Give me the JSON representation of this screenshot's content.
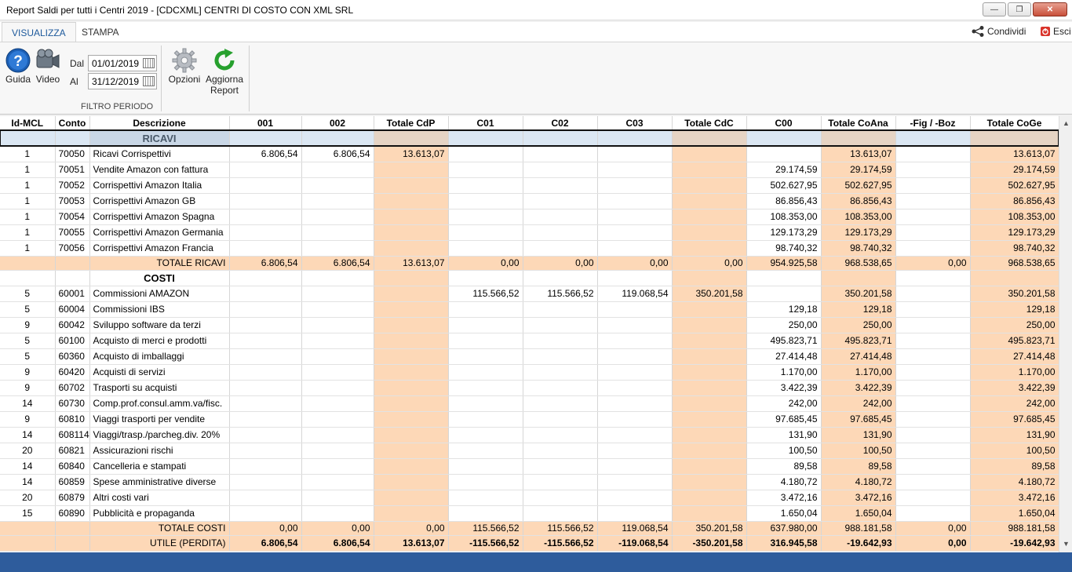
{
  "window": {
    "title": "Report Saldi per tutti i Centri 2019 - [CDCXML] CENTRI DI COSTO CON XML SRL",
    "min": "—",
    "max": "❐",
    "close": "✕"
  },
  "tabs": [
    {
      "label": "VISUALIZZA"
    },
    {
      "label": "STAMPA"
    }
  ],
  "topright": {
    "share": "Condividi",
    "exit": "Esci"
  },
  "ribbon": {
    "guida": "Guida",
    "video": "Video",
    "dal_label": "Dal",
    "al_label": "Al",
    "dal_value": "01/01/2019",
    "al_value": "31/12/2019",
    "group_label": "FILTRO PERIODO",
    "opzioni": "Opzioni",
    "aggiorna1": "Aggiorna",
    "aggiorna2": "Report"
  },
  "columns": [
    "Id-MCL",
    "Conto",
    "Descrizione",
    "001",
    "002",
    "Totale CdP",
    "C01",
    "C02",
    "C03",
    "Totale CdC",
    "C00",
    "Totale CoAna",
    "-Fig / -Boz",
    "Totale CoGe"
  ],
  "sections": {
    "ricavi": "RICAVI",
    "costi": "COSTI"
  },
  "ricavi_rows": [
    [
      "1",
      "70050",
      "Ricavi Corrispettivi",
      "6.806,54",
      "6.806,54",
      "13.613,07",
      "",
      "",
      "",
      "",
      "",
      "13.613,07",
      "",
      "13.613,07"
    ],
    [
      "1",
      "70051",
      "Vendite Amazon con fattura",
      "",
      "",
      "",
      "",
      "",
      "",
      "",
      "29.174,59",
      "29.174,59",
      "",
      "29.174,59"
    ],
    [
      "1",
      "70052",
      "Corrispettivi Amazon Italia",
      "",
      "",
      "",
      "",
      "",
      "",
      "",
      "502.627,95",
      "502.627,95",
      "",
      "502.627,95"
    ],
    [
      "1",
      "70053",
      "Corrispettivi Amazon GB",
      "",
      "",
      "",
      "",
      "",
      "",
      "",
      "86.856,43",
      "86.856,43",
      "",
      "86.856,43"
    ],
    [
      "1",
      "70054",
      "Corrispettivi Amazon Spagna",
      "",
      "",
      "",
      "",
      "",
      "",
      "",
      "108.353,00",
      "108.353,00",
      "",
      "108.353,00"
    ],
    [
      "1",
      "70055",
      "Corrispettivi Amazon Germania",
      "",
      "",
      "",
      "",
      "",
      "",
      "",
      "129.173,29",
      "129.173,29",
      "",
      "129.173,29"
    ],
    [
      "1",
      "70056",
      "Corrispettivi Amazon Francia",
      "",
      "",
      "",
      "",
      "",
      "",
      "",
      "98.740,32",
      "98.740,32",
      "",
      "98.740,32"
    ]
  ],
  "totale_ricavi": [
    "TOTALE RICAVI",
    "6.806,54",
    "6.806,54",
    "13.613,07",
    "0,00",
    "0,00",
    "0,00",
    "0,00",
    "954.925,58",
    "968.538,65",
    "0,00",
    "968.538,65"
  ],
  "costi_rows": [
    [
      "5",
      "60001",
      "Commissioni AMAZON",
      "",
      "",
      "",
      "115.566,52",
      "115.566,52",
      "119.068,54",
      "350.201,58",
      "",
      "350.201,58",
      "",
      "350.201,58"
    ],
    [
      "5",
      "60004",
      "Commissioni IBS",
      "",
      "",
      "",
      "",
      "",
      "",
      "",
      "129,18",
      "129,18",
      "",
      "129,18"
    ],
    [
      "9",
      "60042",
      "Sviluppo software da terzi",
      "",
      "",
      "",
      "",
      "",
      "",
      "",
      "250,00",
      "250,00",
      "",
      "250,00"
    ],
    [
      "5",
      "60100",
      "Acquisto di merci e prodotti",
      "",
      "",
      "",
      "",
      "",
      "",
      "",
      "495.823,71",
      "495.823,71",
      "",
      "495.823,71"
    ],
    [
      "5",
      "60360",
      "Acquisto di imballaggi",
      "",
      "",
      "",
      "",
      "",
      "",
      "",
      "27.414,48",
      "27.414,48",
      "",
      "27.414,48"
    ],
    [
      "9",
      "60420",
      "Acquisti di servizi",
      "",
      "",
      "",
      "",
      "",
      "",
      "",
      "1.170,00",
      "1.170,00",
      "",
      "1.170,00"
    ],
    [
      "9",
      "60702",
      "Trasporti su acquisti",
      "",
      "",
      "",
      "",
      "",
      "",
      "",
      "3.422,39",
      "3.422,39",
      "",
      "3.422,39"
    ],
    [
      "14",
      "60730",
      "Comp.prof.consul.amm.va/fisc.",
      "",
      "",
      "",
      "",
      "",
      "",
      "",
      "242,00",
      "242,00",
      "",
      "242,00"
    ],
    [
      "9",
      "60810",
      "Viaggi trasporti per vendite",
      "",
      "",
      "",
      "",
      "",
      "",
      "",
      "97.685,45",
      "97.685,45",
      "",
      "97.685,45"
    ],
    [
      "14",
      "608114",
      "Viaggi/trasp./parcheg.div. 20%",
      "",
      "",
      "",
      "",
      "",
      "",
      "",
      "131,90",
      "131,90",
      "",
      "131,90"
    ],
    [
      "20",
      "60821",
      "Assicurazioni rischi",
      "",
      "",
      "",
      "",
      "",
      "",
      "",
      "100,50",
      "100,50",
      "",
      "100,50"
    ],
    [
      "14",
      "60840",
      "Cancelleria e stampati",
      "",
      "",
      "",
      "",
      "",
      "",
      "",
      "89,58",
      "89,58",
      "",
      "89,58"
    ],
    [
      "14",
      "60859",
      "Spese amministrative diverse",
      "",
      "",
      "",
      "",
      "",
      "",
      "",
      "4.180,72",
      "4.180,72",
      "",
      "4.180,72"
    ],
    [
      "20",
      "60879",
      "Altri costi vari",
      "",
      "",
      "",
      "",
      "",
      "",
      "",
      "3.472,16",
      "3.472,16",
      "",
      "3.472,16"
    ],
    [
      "15",
      "60890",
      "Pubblicità e propaganda",
      "",
      "",
      "",
      "",
      "",
      "",
      "",
      "1.650,04",
      "1.650,04",
      "",
      "1.650,04"
    ]
  ],
  "totale_costi": [
    "TOTALE COSTI",
    "0,00",
    "0,00",
    "0,00",
    "115.566,52",
    "115.566,52",
    "119.068,54",
    "350.201,58",
    "637.980,00",
    "988.181,58",
    "0,00",
    "988.181,58"
  ],
  "utile": [
    "UTILE (PERDITA)",
    "6.806,54",
    "6.806,54",
    "13.613,07",
    "-115.566,52",
    "-115.566,52",
    "-119.068,54",
    "-350.201,58",
    "316.945,58",
    "-19.642,93",
    "0,00",
    "-19.642,93"
  ],
  "scroll": {
    "up": "▲",
    "down": "▼"
  }
}
